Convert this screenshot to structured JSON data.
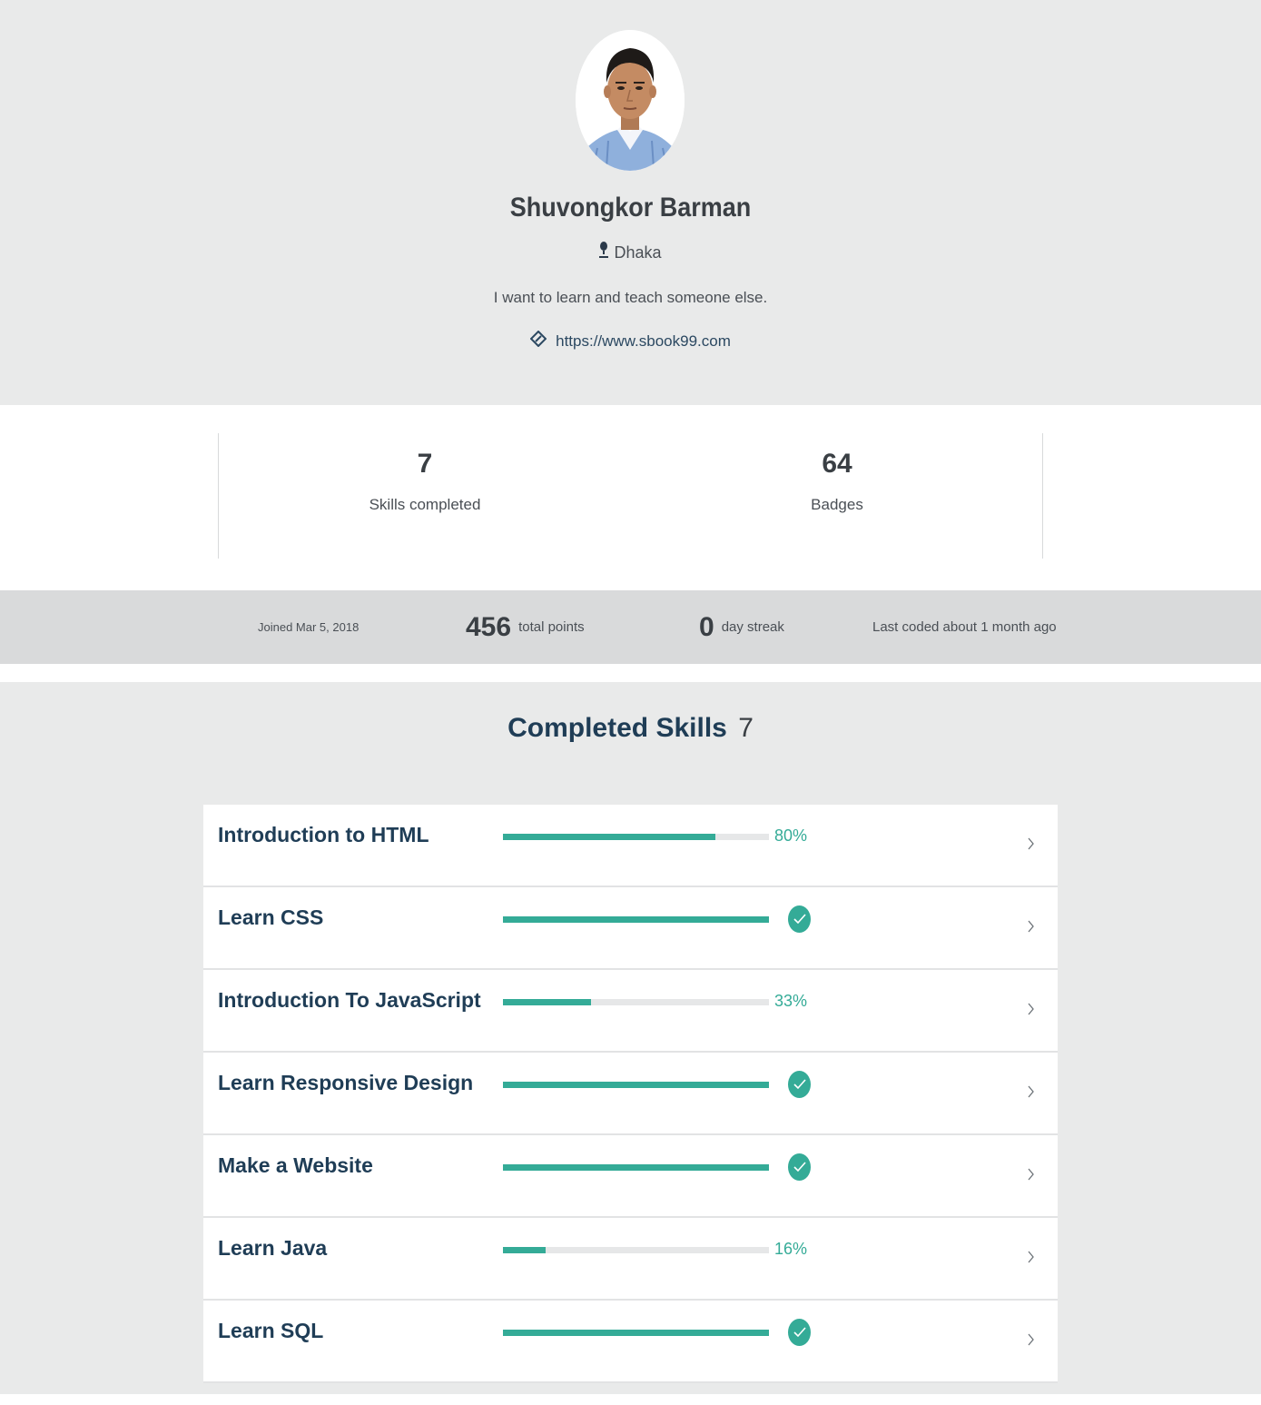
{
  "profile": {
    "name": "Shuvongkor Barman",
    "location": "Dhaka",
    "bio": "I want to learn and teach someone else.",
    "website": "https://www.sbook99.com"
  },
  "stats": {
    "skills_completed": {
      "value": "7",
      "label": "Skills completed"
    },
    "badges": {
      "value": "64",
      "label": "Badges"
    }
  },
  "info_bar": {
    "joined": "Joined Mar 5, 2018",
    "points_value": "456",
    "points_label": "total points",
    "streak_value": "0",
    "streak_label": "day streak",
    "last_coded": "Last coded about 1 month ago"
  },
  "skills_section": {
    "title": "Completed Skills",
    "count": "7",
    "items": [
      {
        "name": "Introduction to HTML",
        "progress": 0.8,
        "percent_label": "80%",
        "completed": false
      },
      {
        "name": "Learn CSS",
        "progress": 1.0,
        "percent_label": "",
        "completed": true
      },
      {
        "name": "Introduction To JavaScript",
        "progress": 0.33,
        "percent_label": "33%",
        "completed": false
      },
      {
        "name": "Learn Responsive Design",
        "progress": 1.0,
        "percent_label": "",
        "completed": true
      },
      {
        "name": "Make a Website",
        "progress": 1.0,
        "percent_label": "",
        "completed": true
      },
      {
        "name": "Learn Java",
        "progress": 0.16,
        "percent_label": "16%",
        "completed": false
      },
      {
        "name": "Learn SQL",
        "progress": 1.0,
        "percent_label": "",
        "completed": true
      }
    ]
  },
  "icons": {
    "location": "map-pin-icon",
    "website": "link-icon",
    "completed": "checkmark-icon",
    "row": "chevron-right-icon"
  },
  "colors": {
    "accent": "#34ab97",
    "heading": "#1f3d56",
    "header_bg": "#e9eaea",
    "info_bar_bg": "#d9dadb"
  }
}
